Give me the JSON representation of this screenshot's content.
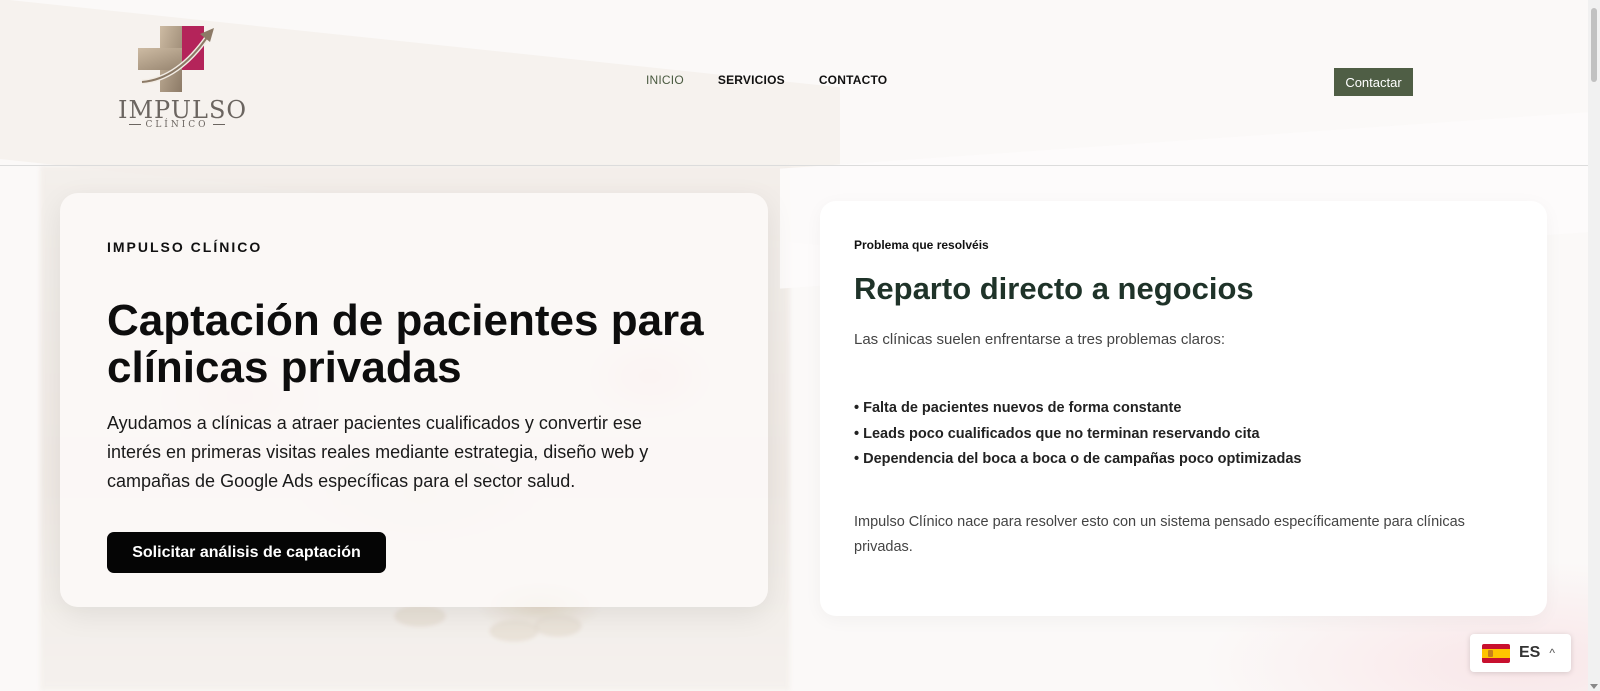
{
  "brand": {
    "name": "IMPULSO",
    "sub": "CLÍNICO",
    "colors": {
      "accent": "#4f5e45",
      "cross_beige": "#b8a48c",
      "cross_magenta": "#b4245a"
    }
  },
  "nav": {
    "items": [
      {
        "label": "INICIO",
        "active": true
      },
      {
        "label": "SERVICIOS",
        "active": false
      },
      {
        "label": "CONTACTO",
        "active": false
      }
    ],
    "cta_label": "Contactar"
  },
  "hero": {
    "eyebrow": "IMPULSO CLÍNICO",
    "title": "Captación de pacientes para clínicas privadas",
    "text": "Ayudamos a clínicas a atraer pacientes cualificados y convertir ese interés en primeras visitas reales mediante estrategia, diseño web y campañas de Google Ads específicas para el sector salud.",
    "button_label": "Solicitar análisis de captación"
  },
  "problem": {
    "eyebrow": "Problema que resolvéis",
    "title": "Reparto directo a negocios",
    "intro": "Las clínicas suelen enfrentarse a tres problemas claros:",
    "items": [
      "• Falta de pacientes nuevos de forma constante",
      "• Leads poco cualificados que no terminan reservando cita",
      "• Dependencia del boca a boca o de campañas poco optimizadas"
    ],
    "outro": "Impulso Clínico nace para resolver esto con un sistema pensado específicamente para clínicas privadas."
  },
  "language": {
    "code": "ES",
    "flag_icon": "spain-flag-icon",
    "caret": "^"
  }
}
